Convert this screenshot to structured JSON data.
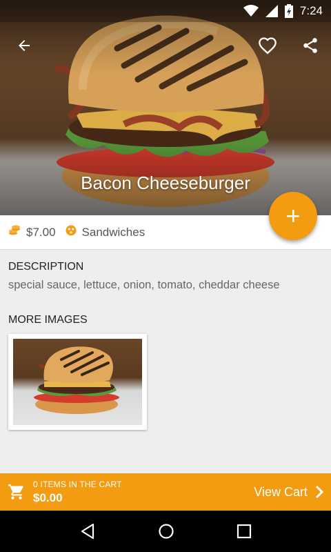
{
  "status_bar": {
    "time": "7:24"
  },
  "product": {
    "name": "Bacon Cheeseburger",
    "price": "$7.00",
    "category": "Sandwiches"
  },
  "sections": {
    "description_label": "DESCRIPTION",
    "description_text": "special sauce, lettuce, onion, tomato, cheddar cheese",
    "more_images_label": "MORE IMAGES"
  },
  "cart": {
    "count_label": "0 ITEMS IN THE CART",
    "total": "$0.00",
    "view_label": "View Cart"
  },
  "colors": {
    "accent": "#f39c12",
    "background": "#eeeeee"
  },
  "icons": [
    "back-arrow-icon",
    "heart-icon",
    "share-icon",
    "add-icon",
    "coins-icon",
    "category-icon",
    "cart-icon",
    "chevron-right-icon",
    "nav-back-icon",
    "nav-home-icon",
    "nav-recents-icon",
    "wifi-icon",
    "signal-icon",
    "battery-icon"
  ]
}
